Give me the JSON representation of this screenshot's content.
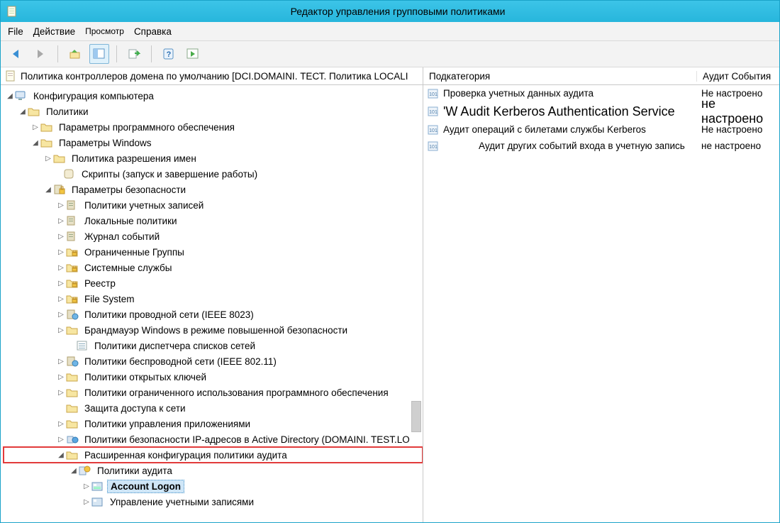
{
  "window": {
    "title": "Редактор управления групповыми политиками"
  },
  "menubar": {
    "file": "File",
    "action": "Действие",
    "view": "Просмотр",
    "help": "Справка"
  },
  "left_head": "Политика контроллеров домена по умолчанию [DCI.DOMAINI. ТЕСТ. Политика LOCALI",
  "tree": {
    "root": "Конфигурация компьютера",
    "policies": "Политики",
    "soft": "Параметры программного обеспечения",
    "win": "Параметры Windows",
    "nameres": "Политика разрешения имен",
    "scripts": "Скрипты (запуск и завершение работы)",
    "sec": "Параметры безопасности",
    "items": [
      "Политики учетных записей",
      "Локальные политики",
      "Журнал событий",
      "Ограниченные Группы",
      "Системные службы",
      "Реестр",
      "File System",
      "Политики проводной сети (IEEE 8023)",
      "Брандмауэр Windows в режиме повышенной безопасности",
      "Политики диспетчера списков сетей",
      "Политики беспроводной сети (IEEE 802.11)",
      "Политики открытых ключей",
      "Политики ограниченного использования программного обеспечения",
      "Защита доступа к сети",
      "Политики управления приложениями",
      "Политики безопасности IP-адресов в Active Directory (DOMAINI. TEST.LO"
    ],
    "adv": "Расширенная конфигурация политики аудита",
    "auditpol": "Политики аудита",
    "acctlogon": "Account Logon",
    "acctmgmt": "Управление учетными записями"
  },
  "right_head": {
    "sub": "Подкатегория",
    "aud": "Аудит События"
  },
  "rows": [
    {
      "txt": "Проверка учетных данных аудита",
      "aud": "Не настроено",
      "big": false
    },
    {
      "txt": "'W Audit Kerberos Authentication Service",
      "aud": "не настроено",
      "big": true
    },
    {
      "txt": "Аудит операций с билетами службы Kerberos",
      "aud": "Не настроено",
      "big": false
    },
    {
      "txt": "Аудит других событий входа в учетную запись",
      "aud": "не настроено",
      "big": false
    }
  ]
}
